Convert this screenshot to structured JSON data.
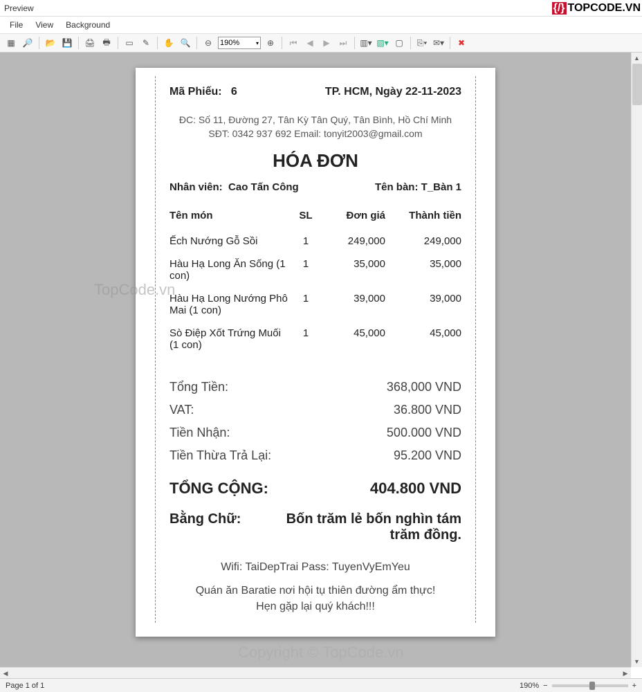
{
  "window": {
    "title": "Preview"
  },
  "menu": {
    "items": [
      "File",
      "View",
      "Background"
    ]
  },
  "logo": {
    "bracket": "{/}",
    "text": "TOPCODE.VN"
  },
  "toolbar": {
    "zoom_value": "190%"
  },
  "receipt": {
    "slip_label": "Mã Phiếu:",
    "slip_no": "6",
    "city_date": "TP. HCM, Ngày 22-11-2023",
    "addr1": "ĐC: Số 11, Đường 27, Tân Kỳ Tân Quý, Tân Bình, Hồ Chí Minh",
    "addr2": "SĐT: 0342 937 692    Email: tonyit2003@gmail.com",
    "title": "HÓA ĐƠN",
    "staff_label": "Nhân viên:",
    "staff": "Cao Tấn Công",
    "table_label": "Tên bàn:",
    "table": "T_Bàn 1",
    "cols": {
      "name": "Tên món",
      "qty": "SL",
      "price": "Đơn giá",
      "amount": "Thành tiền"
    },
    "items": [
      {
        "name": "Ếch Nướng Gỗ Sồi",
        "qty": "1",
        "price": "249,000",
        "amount": "249,000"
      },
      {
        "name": "Hàu Hạ Long Ăn Sống (1 con)",
        "qty": "1",
        "price": "35,000",
        "amount": "35,000"
      },
      {
        "name": "Hàu Hạ Long Nướng Phô Mai (1 con)",
        "qty": "1",
        "price": "39,000",
        "amount": "39,000"
      },
      {
        "name": "Sò Điệp Xốt Trứng Muối (1 con)",
        "qty": "1",
        "price": "45,000",
        "amount": "45,000"
      }
    ],
    "totals": [
      {
        "label": "Tổng Tiền:",
        "value": "368,000 VND"
      },
      {
        "label": "VAT:",
        "value": "36.800 VND"
      },
      {
        "label": "Tiền Nhận:",
        "value": "500.000 VND"
      },
      {
        "label": "Tiền Thừa Trả Lại:",
        "value": "95.200 VND"
      }
    ],
    "grand_label": "TỔNG CỘNG:",
    "grand_value": "404.800 VND",
    "words_label": "Bằng Chữ:",
    "words_value": "Bốn trăm lẻ bốn nghìn tám trăm đồng.",
    "wifi": "Wifi: TaiDepTrai    Pass: TuyenVyEmYeu",
    "bye1": "Quán ăn Baratie nơi hội tụ thiên đường ẩm thực!",
    "bye2": "Hẹn gặp lại quý khách!!!"
  },
  "watermark": {
    "a": "TopCode.vn",
    "b": "Copyright © TopCode.vn"
  },
  "status": {
    "page": "Page 1 of 1",
    "zoom": "190%"
  }
}
